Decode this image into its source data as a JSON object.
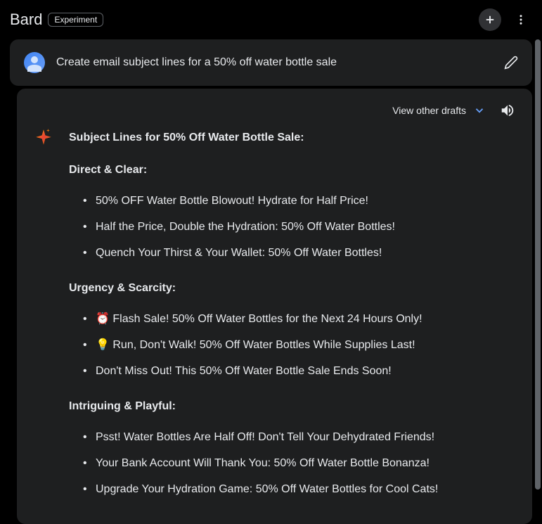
{
  "header": {
    "logo": "Bard",
    "badge": "Experiment"
  },
  "conversation": {
    "user_prompt": "Create email subject lines for a 50% off water bottle sale",
    "view_drafts_label": "View other drafts",
    "response": {
      "title": "Subject Lines for 50% Off Water Bottle Sale:",
      "sections": [
        {
          "heading": "Direct & Clear:",
          "items": [
            "50% OFF Water Bottle Blowout! Hydrate for Half Price!",
            "Half the Price, Double the Hydration: 50% Off Water Bottles!",
            "Quench Your Thirst & Your Wallet: 50% Off Water Bottles!"
          ]
        },
        {
          "heading": "Urgency & Scarcity:",
          "items": [
            "⏰ Flash Sale! 50% Off Water Bottles for the Next 24 Hours Only!",
            "💡 Run, Don't Walk! 50% Off Water Bottles While Supplies Last!",
            "Don't Miss Out! This 50% Off Water Bottle Sale Ends Soon!"
          ]
        },
        {
          "heading": "Intriguing & Playful:",
          "items": [
            "Psst! Water Bottles Are Half Off! Don't Tell Your Dehydrated Friends!",
            "Your Bank Account Will Thank You: 50% Off Water Bottle Bonanza!",
            "Upgrade Your Hydration Game: 50% Off Water Bottles for Cool Cats!"
          ]
        }
      ]
    }
  }
}
